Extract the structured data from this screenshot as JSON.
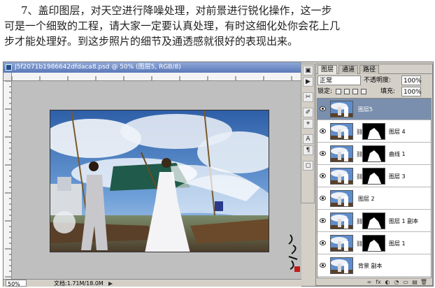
{
  "instructions": {
    "line1": "7、盖印图层，对天空进行降噪处理，对前景进行锐化操作，这一步",
    "line2": "可是一个细致的工程，请大家一定要认真处理，有时这细化处你会花上几",
    "line3": "步才能处理好。到这步照片的细节及通透感就很好的表现出来。"
  },
  "document": {
    "title": "J5f2071b1986642dfdaca8.psd @ 50% (图层5, RGB/8)",
    "zoom": "50%",
    "doc_size": "文档:1.71M/18.0M",
    "status_arrow": "▶"
  },
  "toolbox": {
    "tools": [
      "▣",
      "▶",
      "✂",
      "✐",
      "⌖",
      "A",
      "¶",
      "◻"
    ]
  },
  "layers_panel": {
    "tabs": [
      "图层",
      "通道",
      "路径"
    ],
    "blend_mode": "正常",
    "opacity_label": "不透明度:",
    "opacity_value": "100%",
    "lock_label": "锁定:",
    "fill_label": "填充:",
    "fill_value": "100%",
    "layers": [
      {
        "name": "图层5",
        "selected": true,
        "mask": false
      },
      {
        "name": "图层 4",
        "selected": false,
        "mask": true
      },
      {
        "name": "曲线 1",
        "selected": false,
        "mask": true
      },
      {
        "name": "图层 3",
        "selected": false,
        "mask": true
      },
      {
        "name": "图层 2",
        "selected": false,
        "mask": false
      },
      {
        "name": "图层 1 副本",
        "selected": false,
        "mask": true
      },
      {
        "name": "图层 1",
        "selected": false,
        "mask": true
      },
      {
        "name": "背景 副本",
        "selected": false,
        "mask": false
      }
    ],
    "bottom_icons": [
      "∞",
      "fx",
      "◐",
      "◔",
      "▭",
      "▤",
      "🗑"
    ]
  },
  "colors": {
    "selected_layer": "#7a8fae",
    "titlebar": "#5a78b8"
  }
}
